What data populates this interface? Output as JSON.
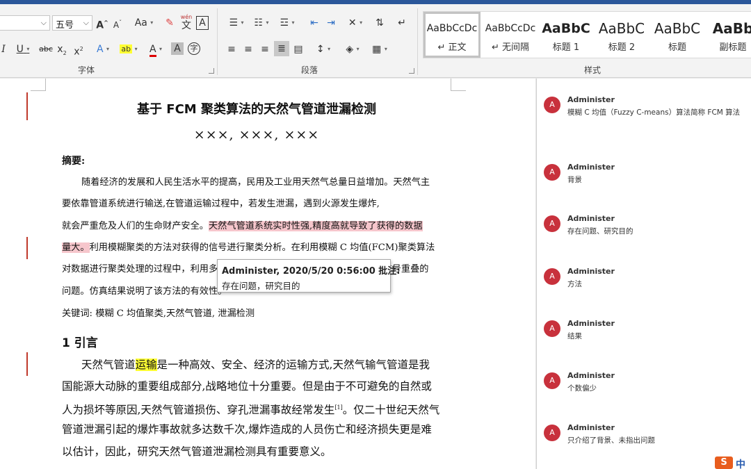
{
  "ribbon": {
    "font_size_value": "五号",
    "font_group_label": "字体",
    "paragraph_group_label": "段落",
    "styles_group_label": "样式",
    "font_buttons": {
      "grow": "A",
      "shrink": "A",
      "case": "Aa",
      "pinyin_top": "wén",
      "pinyin_bottom": "文",
      "border": "A",
      "italic": "I",
      "underline": "U",
      "strike": "abc",
      "subscript": "x",
      "superscript": "x",
      "effects": "A",
      "highlight": "ab",
      "font_color": "A",
      "shading": "A",
      "enclose": "字"
    },
    "styles": [
      {
        "sample": "AaBbCcDc",
        "name": "↵ 正文"
      },
      {
        "sample": "AaBbCcDc",
        "name": "↵ 无间隔"
      },
      {
        "sample": "AaBbC",
        "name": "标题 1"
      },
      {
        "sample": "AaBbC",
        "name": "标题 2"
      },
      {
        "sample": "AaBbC",
        "name": "标题"
      },
      {
        "sample": "AaBb",
        "name": "副标题"
      }
    ]
  },
  "document": {
    "title": "基于 FCM 聚类算法的天然气管道泄漏检测",
    "authors": "×××, ×××, ×××",
    "abstract_heading": "摘要:",
    "abstract_lines": [
      "随着经济的发展和人民生活水平的提高，民用及工业用天然气总量日益增加。天然气主",
      "要依靠管道系统进行输送,在管道运输过程中，若发生泄漏，遇到火源发生爆炸,",
      "就会严重危及人们的生命财产安全。",
      "天然气管道系统实时性强,精度高就导致了获得的数据",
      "量大。",
      "利用模糊聚类的方法对获得的信号进行聚类分析。在利用模糊 C 均值(FCM)聚类算法",
      "对数据进行聚类处理的过程中，利用多个特征向量对模糊聚类中心定位，解决了信号重叠的",
      "问题。仿真结果说明了该方法的有效性。"
    ],
    "keywords": "关键词: 模糊 C 均值聚类,天然气管道, 泄漏检测",
    "section_heading": "1  引言",
    "intro_lines": [
      "天然气管道",
      "运输",
      "是一种高效、安全、经济的运输方式,天然气输气管道是我",
      "国能源大动脉的重要组成部分,战略地位十分重要。但是由于不可避免的自然或",
      "人为损坏等原因,天然气管道损伤、穿孔泄漏事故经常发生",
      "[1]",
      "。仅二十世纪天然气",
      "管道泄漏引起的爆炸事故就多达数千次,爆炸造成的人员伤亡和经济损失更是难",
      "以估计，因此，研究天然气管道泄漏检测具有重要意义。"
    ]
  },
  "tooltip": {
    "header": "Administer, 2020/5/20 0:56:00 批注:",
    "body": "存在问题，研究目的"
  },
  "comments": [
    {
      "initial": "A",
      "author": "Administer",
      "text": "模糊 C 均值（Fuzzy C-means）算法简称 FCM 算法"
    },
    {
      "initial": "A",
      "author": "Administer",
      "text": "背景"
    },
    {
      "initial": "A",
      "author": "Administer",
      "text": "存在问题、研究目的"
    },
    {
      "initial": "A",
      "author": "Administer",
      "text": "方法"
    },
    {
      "initial": "A",
      "author": "Administer",
      "text": "结果"
    },
    {
      "initial": "A",
      "author": "Administer",
      "text": "个数偏少"
    },
    {
      "initial": "A",
      "author": "Administer",
      "text": "只介绍了背景、未指出问题"
    }
  ],
  "colors": {
    "accent": "#2b579a",
    "avatar": "#c8313c",
    "highlight_red": "#f6c6cc",
    "highlight_yellow": "#ffff33",
    "revision_bar": "#c0392b"
  },
  "logo": {
    "mark": "S",
    "text": "中"
  }
}
